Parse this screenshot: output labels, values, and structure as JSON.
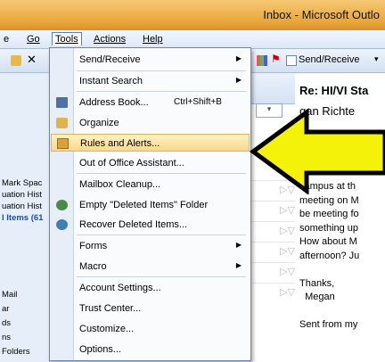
{
  "window": {
    "title": "Inbox - Microsoft Outlo"
  },
  "menubar": {
    "items": [
      "e",
      "Go",
      "Tools",
      "Actions",
      "Help"
    ]
  },
  "toolbar": {
    "send_receive": "Send/Receive",
    "send_receive_arrow": "▾"
  },
  "nav": {
    "items": [
      {
        "label": "Mark Spac",
        "style": "normal"
      },
      {
        "label": "uation Hist",
        "style": "normal"
      },
      {
        "label": "uation Hist",
        "style": "normal"
      },
      {
        "label": "l Items (61",
        "style": "blue"
      },
      {
        "label": "Mail",
        "style": "normal"
      },
      {
        "label": "ar",
        "style": "normal"
      },
      {
        "label": "ds",
        "style": "normal"
      },
      {
        "label": "ns",
        "style": "normal"
      },
      {
        "label": "Folders",
        "style": "normal"
      }
    ]
  },
  "tools_menu": {
    "items": [
      {
        "label": "Send/Receive",
        "icon": "",
        "submenu": true
      },
      {
        "label": "Instant Search",
        "icon": "",
        "submenu": true
      },
      {
        "label": "Address Book...",
        "shortcut": "Ctrl+Shift+B",
        "icon": "address-book-icon"
      },
      {
        "label": "Organize",
        "icon": "organize-icon"
      },
      {
        "label": "Rules and Alerts...",
        "icon": "rules-icon",
        "highlighted": true
      },
      {
        "label": "Out of Office Assistant...",
        "icon": ""
      },
      {
        "label": "Mailbox Cleanup...",
        "icon": ""
      },
      {
        "label": "Empty \"Deleted Items\" Folder",
        "icon": "recycle-icon"
      },
      {
        "label": "Recover Deleted Items...",
        "icon": "recover-icon"
      },
      {
        "label": "Forms",
        "icon": "",
        "submenu": true
      },
      {
        "label": "Macro",
        "icon": "",
        "submenu": true
      },
      {
        "label": "Account Settings...",
        "icon": ""
      },
      {
        "label": "Trust Center...",
        "icon": ""
      },
      {
        "label": "Customize...",
        "icon": ""
      },
      {
        "label": "Options...",
        "icon": ""
      }
    ]
  },
  "reading_pane": {
    "subject": "Re: HI/VI Sta",
    "from": "gan Richte",
    "body": "campus at th\nmeeting on M\nbe meeting fo\nsomething up\nHow about M\nafternoon? Ju\n\nThanks,\n  Megan\n\nSent from my"
  },
  "colors": {
    "arrow_fill": "#f5f20a",
    "arrow_stroke": "#000000",
    "highlight": "#f9d88a"
  }
}
